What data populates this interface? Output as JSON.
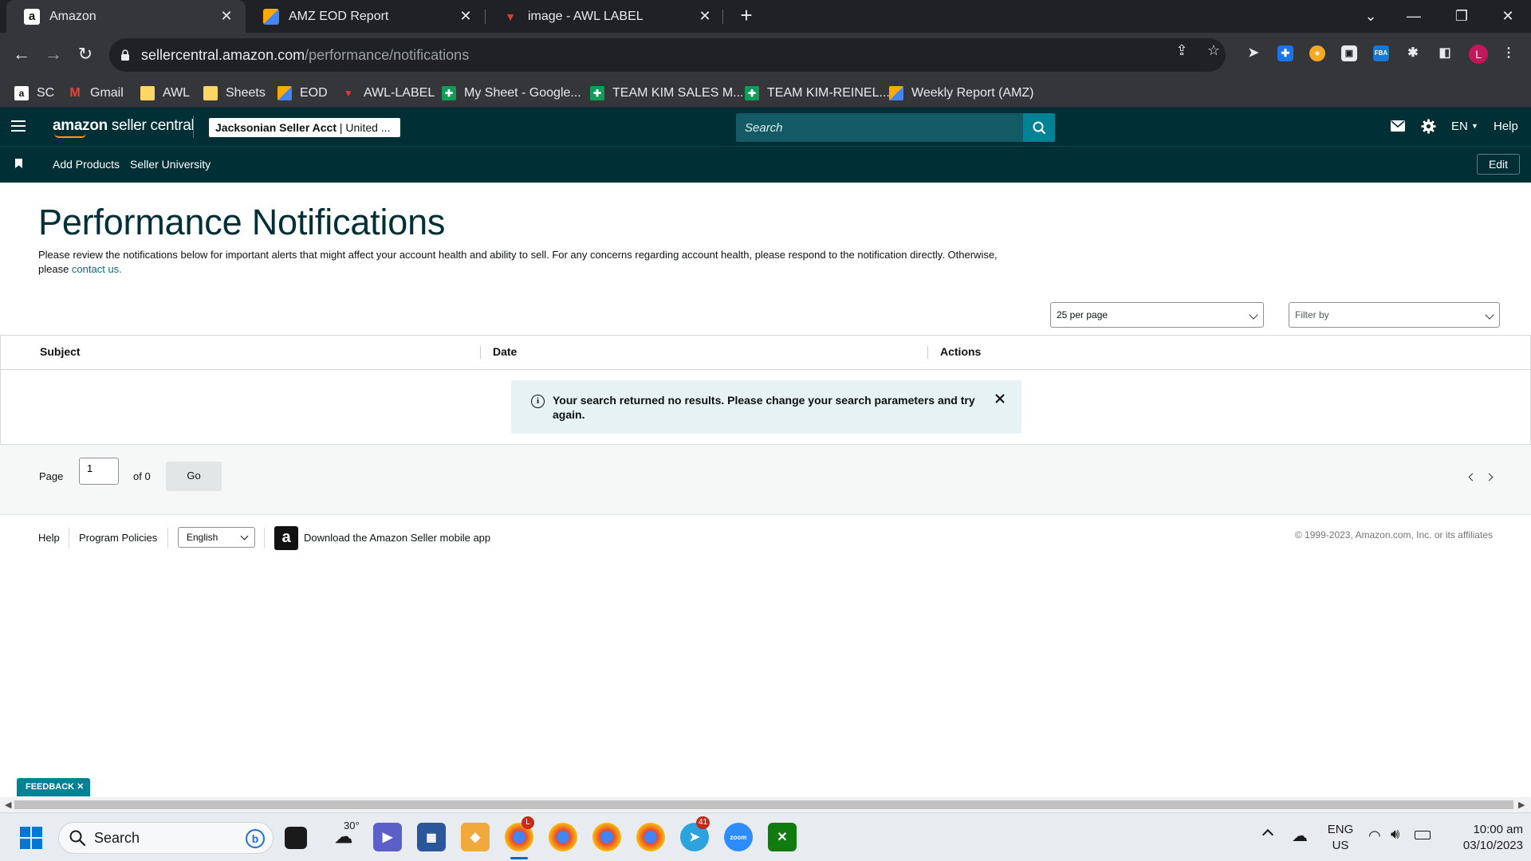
{
  "browser": {
    "tabs": [
      {
        "title": "Amazon",
        "active": true
      },
      {
        "title": "AMZ EOD Report",
        "active": false
      },
      {
        "title": "image - AWL LABEL",
        "active": false
      }
    ],
    "url_host": "sellercentral.amazon.com",
    "url_path": "/performance/notifications",
    "profile_initial": "L",
    "bookmarks": [
      {
        "label": "SC",
        "icon": "amazon-icon"
      },
      {
        "label": "Gmail",
        "icon": "gmail-icon"
      },
      {
        "label": "AWL",
        "icon": "folder-icon"
      },
      {
        "label": "Sheets",
        "icon": "folder-icon"
      },
      {
        "label": "EOD",
        "icon": "eod-icon"
      },
      {
        "label": "AWL-LABEL",
        "icon": "awl-label-icon"
      },
      {
        "label": "My Sheet - Google...",
        "icon": "sheets-icon"
      },
      {
        "label": "TEAM KIM SALES M...",
        "icon": "sheets-icon"
      },
      {
        "label": "TEAM KIM-REINEL...",
        "icon": "sheets-icon"
      },
      {
        "label": "Weekly Report (AMZ)",
        "icon": "eod-icon"
      }
    ]
  },
  "header": {
    "logo_bold": "amazon",
    "logo_rest": " seller central",
    "account_name": "Jacksonian Seller Acct",
    "account_region": " | United ...",
    "search_placeholder": "Search",
    "language": "EN",
    "help": "Help"
  },
  "nav": {
    "links": [
      "Add Products",
      "Seller University"
    ],
    "edit": "Edit"
  },
  "main": {
    "title": "Performance Notifications",
    "description": "Please review the notifications below for important alerts that might affect your account health and ability to sell. For any concerns regarding account health, please respond to the notification directly. Otherwise, please ",
    "contact_link": "contact us",
    "contact_suffix": ".",
    "per_page": "25 per page",
    "filter_placeholder": "Filter by",
    "columns": [
      "Subject",
      "Date",
      "Actions"
    ],
    "alert_message": "Your search returned no results. Please change your search parameters and try again.",
    "pager": {
      "page_label": "Page",
      "current_page": "1",
      "of_label": "of 0",
      "go_label": "Go"
    }
  },
  "footer": {
    "help": "Help",
    "program_policies": "Program Policies",
    "language": "English",
    "download_app": "Download the Amazon Seller mobile app",
    "copyright": "© 1999-2023, Amazon.com, Inc. or its affiliates"
  },
  "feedback": "FEEDBACK",
  "taskbar": {
    "search_label": "Search",
    "weather_temp": "30°",
    "chrome_badge": "L",
    "telegram_badge": "41",
    "lang_top": "ENG",
    "lang_bottom": "US",
    "time": "10:00 am",
    "date": "03/10/2023"
  },
  "colors": {
    "header_bg": "#002f36",
    "accent_teal": "#008296",
    "link": "#007185",
    "alert_bg": "#e6f2f4"
  }
}
